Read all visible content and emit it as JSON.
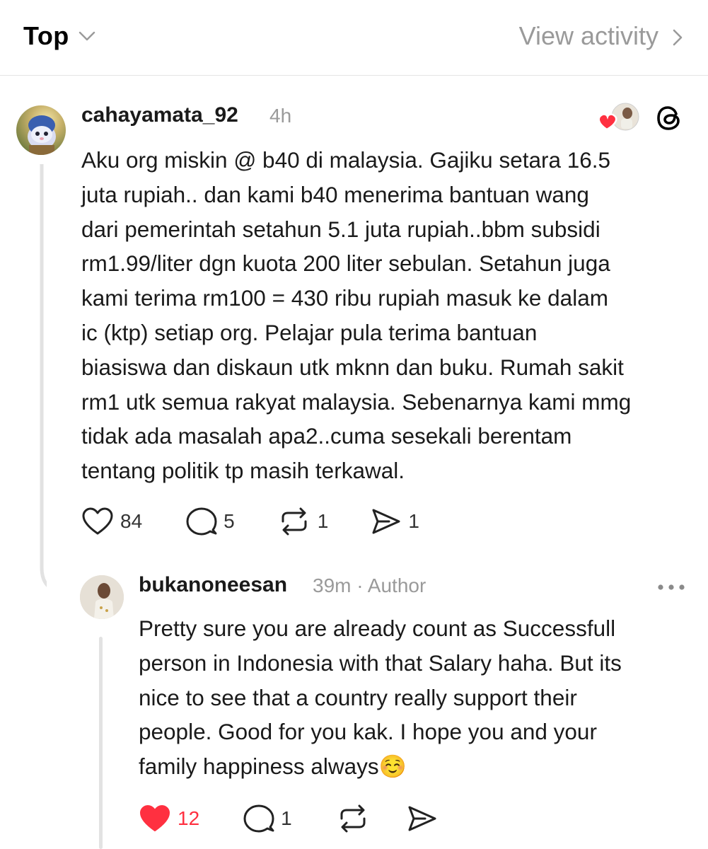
{
  "header": {
    "sort_label": "Top",
    "view_activity_label": "View activity"
  },
  "post": {
    "username": "cahayamata_92",
    "time": "4h",
    "body_lines": [
      "Aku org miskin @ b40 di malaysia. Gajiku setara 16.5",
      "juta rupiah.. dan kami b40 menerima bantuan wang",
      "dari pemerintah setahun 5.1 juta rupiah..bbm subsidi",
      "rm1.99/liter dgn kuota 200 liter sebulan. Setahun juga",
      "kami terima rm100 = 430 ribu rupiah masuk ke dalam",
      "ic (ktp) setiap org. Pelajar pula terima bantuan",
      "biasiswa dan diskaun utk mknn dan buku. Rumah sakit",
      "rm1 utk semua rakyat malaysia. Sebenarnya kami mmg",
      "tidak ada masalah apa2..cuma sesekali berentam",
      "tentang politik tp masih terkawal."
    ],
    "likes": "84",
    "replies": "5",
    "reposts": "1",
    "shares": "1"
  },
  "reply": {
    "username": "bukanoneesan",
    "meta": "39m · Author",
    "body_lines": [
      "Pretty sure you are already count as Successfull",
      "person in Indonesia with that Salary haha. But its",
      "nice to see that a country really support their",
      "people. Good for you kak. I hope you and your",
      "family happiness always☺️"
    ],
    "likes": "12",
    "replies": "1"
  },
  "colors": {
    "like_red": "#ff3040",
    "muted_text": "#9a9a9a"
  },
  "icons": [
    "chevron-down-icon",
    "chevron-right-icon",
    "heart-icon",
    "comment-icon",
    "repost-icon",
    "share-icon",
    "threads-logo-icon",
    "more-icon"
  ]
}
